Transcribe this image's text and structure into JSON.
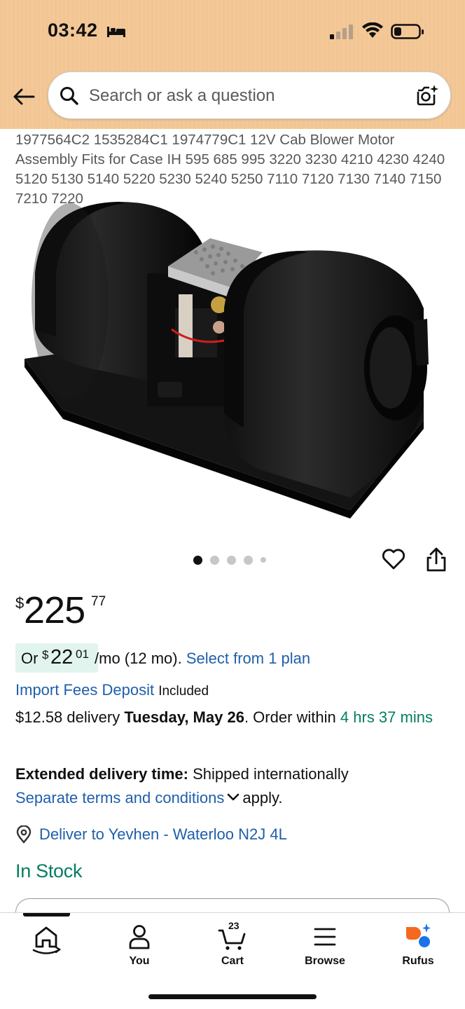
{
  "status_bar": {
    "time": "03:42",
    "icons": [
      "bed-icon",
      "cellular-signal-icon",
      "wifi-icon",
      "battery-icon"
    ]
  },
  "header": {
    "back_icon": "back-arrow-icon",
    "search": {
      "placeholder": "Search or ask a question",
      "value": ""
    },
    "camera_icon": "camera-search-icon",
    "background_color": "#f3c796"
  },
  "product": {
    "title": "1977564C2 1535284C1 1974779C1 12V Cab Blower Motor Assembly Fits for Case IH 595 685 995 3220 3230 4210 4230 4240 5120 5130 5140 5220 5230 5240 5250 7110 7120 7130 7140 7150 7210 7220",
    "image_alt": "Cab blower motor assembly",
    "carousel": {
      "count": 5,
      "active_index": 0
    },
    "price": {
      "symbol": "$",
      "whole": "225",
      "fraction": "77"
    },
    "financing": {
      "prefix": "Or",
      "symbol": "$",
      "whole": "22",
      "fraction": "01",
      "suffix": "/mo (12 mo).",
      "link": "Select from 1 plan"
    },
    "import_fees": {
      "link": "Import Fees Deposit",
      "status": "Included"
    },
    "delivery": {
      "cost": "$12.58 delivery",
      "date": "Tuesday, May 26",
      "order_prefix": ". Order within",
      "countdown": "4 hrs 37 mins"
    },
    "extended_delivery": {
      "label": "Extended delivery time:",
      "text": "Shipped internationally",
      "link": "Separate terms and conditions",
      "suffix": "apply."
    },
    "deliver_to": "Deliver to Yevhen - Waterloo N2J 4L",
    "stock_status": "In Stock"
  },
  "bottom_nav": {
    "items": [
      {
        "label": "",
        "icon": "home-icon",
        "active": true
      },
      {
        "label": "You",
        "icon": "person-icon"
      },
      {
        "label": "Cart",
        "icon": "cart-icon",
        "badge": "23"
      },
      {
        "label": "Browse",
        "icon": "menu-icon"
      },
      {
        "label": "Rufus",
        "icon": "rufus-icon"
      }
    ]
  },
  "colors": {
    "link": "#1f5faa",
    "green": "#067d62",
    "financing_bg": "#e2f4ee",
    "header": "#f3c796"
  }
}
